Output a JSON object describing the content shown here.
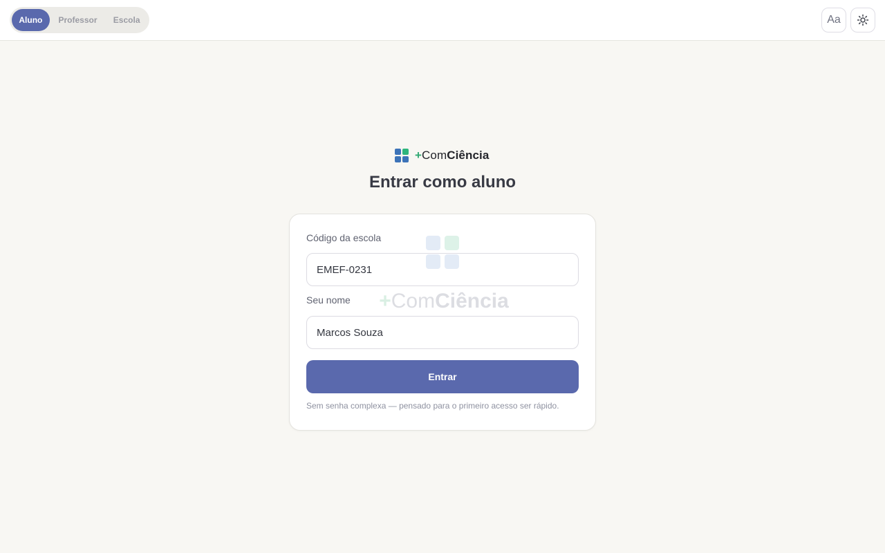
{
  "topbar": {
    "roles": [
      {
        "label": "Aluno",
        "active": true
      },
      {
        "label": "Professor",
        "active": false
      },
      {
        "label": "Escola",
        "active": false
      }
    ],
    "font_size_label": "Aa",
    "theme_icon": "sun-icon"
  },
  "brand": {
    "plus": "+",
    "light": "Com",
    "bold": "Ciência"
  },
  "page": {
    "title": "Entrar como aluno"
  },
  "form": {
    "code_label": "Código da escola",
    "code_value": "EMEF-0231",
    "name_label": "Seu nome",
    "name_value": "Marcos Souza",
    "submit_label": "Entrar",
    "hint": "Sem senha complexa — pensado para o primeiro acesso ser rápido."
  },
  "colors": {
    "accent": "#5a69ad",
    "brand_blue": "#3c73b8",
    "brand_green": "#2fb57c",
    "background": "#f8f7f3"
  }
}
